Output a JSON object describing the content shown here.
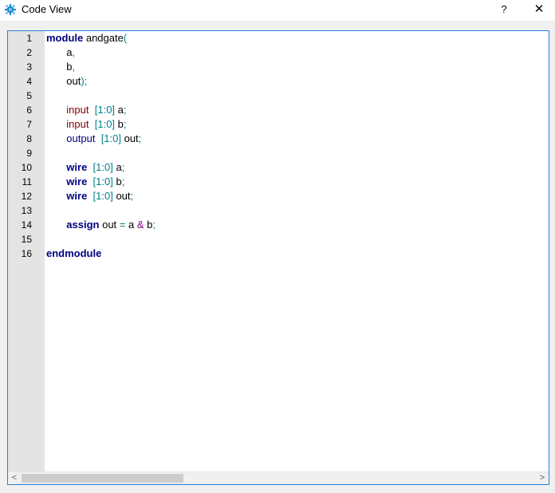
{
  "window": {
    "title": "Code View",
    "help_label": "?",
    "close_label": "✕",
    "icon": "gear-app-icon"
  },
  "editor": {
    "line_numbers": [
      "1",
      "2",
      "3",
      "4",
      "5",
      "6",
      "7",
      "8",
      "9",
      "10",
      "11",
      "12",
      "13",
      "14",
      "15",
      "16"
    ],
    "lines": [
      [
        {
          "t": "module",
          "c": "kw"
        },
        {
          "t": " andgate",
          "c": ""
        },
        {
          "t": "(",
          "c": "punct"
        }
      ],
      [
        {
          "t": "       a",
          "c": ""
        },
        {
          "t": ",",
          "c": "punct"
        }
      ],
      [
        {
          "t": "       b",
          "c": ""
        },
        {
          "t": ",",
          "c": "punct"
        }
      ],
      [
        {
          "t": "       out",
          "c": ""
        },
        {
          "t": ");",
          "c": "punct"
        }
      ],
      [],
      [
        {
          "t": "       ",
          "c": ""
        },
        {
          "t": "input",
          "c": "port"
        },
        {
          "t": "  ",
          "c": ""
        },
        {
          "t": "[1:0]",
          "c": "range"
        },
        {
          "t": " a",
          "c": ""
        },
        {
          "t": ";",
          "c": "punct"
        }
      ],
      [
        {
          "t": "       ",
          "c": ""
        },
        {
          "t": "input",
          "c": "port"
        },
        {
          "t": "  ",
          "c": ""
        },
        {
          "t": "[1:0]",
          "c": "range"
        },
        {
          "t": " b",
          "c": ""
        },
        {
          "t": ";",
          "c": "punct"
        }
      ],
      [
        {
          "t": "       ",
          "c": ""
        },
        {
          "t": "output",
          "c": "out-kw"
        },
        {
          "t": "  ",
          "c": ""
        },
        {
          "t": "[1:0]",
          "c": "range"
        },
        {
          "t": " out",
          "c": ""
        },
        {
          "t": ";",
          "c": "punct"
        }
      ],
      [],
      [
        {
          "t": "       ",
          "c": ""
        },
        {
          "t": "wire",
          "c": "kw"
        },
        {
          "t": "  ",
          "c": ""
        },
        {
          "t": "[1:0]",
          "c": "range"
        },
        {
          "t": " a",
          "c": ""
        },
        {
          "t": ";",
          "c": "punct"
        }
      ],
      [
        {
          "t": "       ",
          "c": ""
        },
        {
          "t": "wire",
          "c": "kw"
        },
        {
          "t": "  ",
          "c": ""
        },
        {
          "t": "[1:0]",
          "c": "range"
        },
        {
          "t": " b",
          "c": ""
        },
        {
          "t": ";",
          "c": "punct"
        }
      ],
      [
        {
          "t": "       ",
          "c": ""
        },
        {
          "t": "wire",
          "c": "kw"
        },
        {
          "t": "  ",
          "c": ""
        },
        {
          "t": "[1:0]",
          "c": "range"
        },
        {
          "t": " out",
          "c": ""
        },
        {
          "t": ";",
          "c": "punct"
        }
      ],
      [],
      [
        {
          "t": "       ",
          "c": ""
        },
        {
          "t": "assign",
          "c": "kw"
        },
        {
          "t": " out ",
          "c": ""
        },
        {
          "t": "=",
          "c": "punct"
        },
        {
          "t": " a ",
          "c": ""
        },
        {
          "t": "&",
          "c": "amp"
        },
        {
          "t": " b",
          "c": ""
        },
        {
          "t": ";",
          "c": "punct"
        }
      ],
      [],
      [
        {
          "t": "endmodule",
          "c": "kw"
        }
      ]
    ]
  },
  "scrollbar": {
    "left_arrow": "<",
    "right_arrow": ">",
    "position": 0
  },
  "colors": {
    "keyword": "#000080",
    "port": "#800000",
    "range": "#00808a",
    "frame_border": "#2a7fd6"
  }
}
